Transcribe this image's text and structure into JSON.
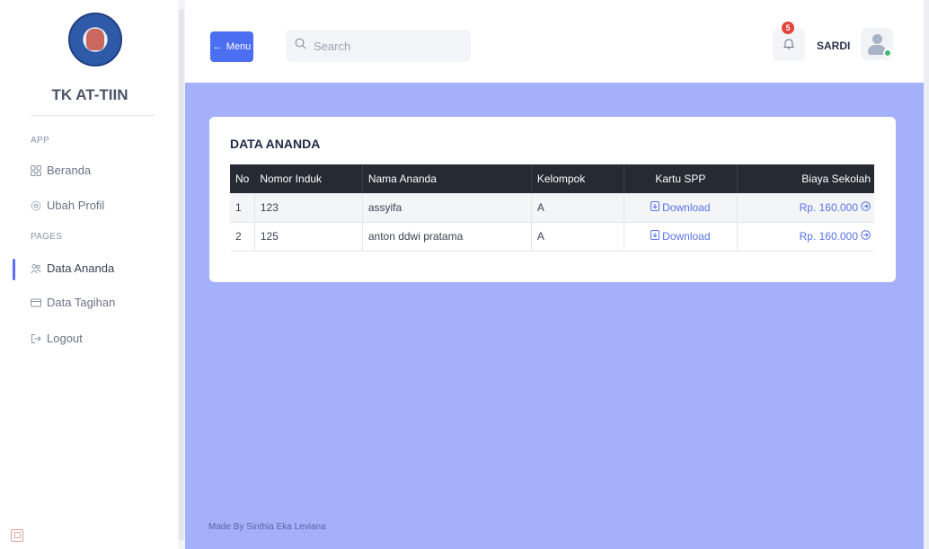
{
  "brand": {
    "name": "TK AT-TIIN"
  },
  "sidebar": {
    "sections": [
      {
        "label": "APP"
      },
      {
        "label": "PAGES"
      }
    ],
    "items": [
      {
        "label": "Beranda",
        "icon": "grid-icon"
      },
      {
        "label": "Ubah Profil",
        "icon": "gear-icon"
      },
      {
        "label": "Data Ananda",
        "icon": "users-icon"
      },
      {
        "label": "Data Tagihan",
        "icon": "card-icon"
      },
      {
        "label": "Logout",
        "icon": "logout-icon"
      }
    ],
    "active": "Data Ananda"
  },
  "topbar": {
    "menu_label": "Menu",
    "search_placeholder": "Search",
    "notification_count": "5",
    "username": "SARDI"
  },
  "card": {
    "title": "DATA ANANDA",
    "columns": [
      "No",
      "Nomor Induk",
      "Nama Ananda",
      "Kelompok",
      "Kartu SPP",
      "Biaya Sekolah"
    ],
    "rows": [
      {
        "no": "1",
        "nomor_induk": "123",
        "nama": "assyifa",
        "kelompok": "A",
        "kartu": "Download",
        "biaya": "Rp. 160.000"
      },
      {
        "no": "2",
        "nomor_induk": "125",
        "nama": "anton ddwi pratama",
        "kelompok": "A",
        "kartu": "Download",
        "biaya": "Rp. 160.000"
      }
    ]
  },
  "footer": {
    "text": "Made By Sinthia Eka Leviana"
  },
  "colors": {
    "accent": "#4c6ef0",
    "main_bg": "#a4b0fa",
    "table_header": "#262a33",
    "link": "#5873e8",
    "badge": "#e0443a",
    "online": "#3dbb6b"
  }
}
